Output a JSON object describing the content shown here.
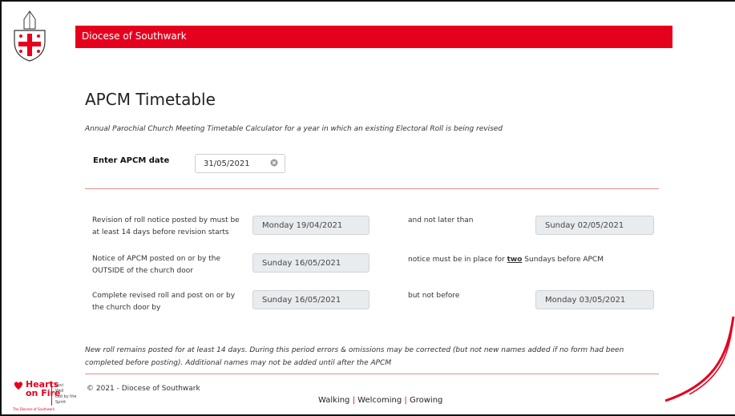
{
  "header": {
    "banner_title": "Diocese of Southwark"
  },
  "page": {
    "title": "APCM Timetable",
    "subtitle": "Annual Parochial Church Meeting Timetable Calculator for a year in which an existing Electoral Roll is being revised"
  },
  "apcm_date": {
    "label": "Enter APCM date",
    "value": "31/05/2021"
  },
  "rows": [
    {
      "left_label_1": "Revision of roll notice posted by must be",
      "left_label_2": "at least 14 days before revision starts",
      "left_value": "Monday 19/04/2021",
      "right_label": "and not later than",
      "right_value": "Sunday 02/05/2021"
    },
    {
      "left_label_1": "Notice of APCM posted on or by the",
      "left_label_2": "OUTSIDE of the church door",
      "left_value": "Sunday 16/05/2021",
      "right_label_pre": "notice must be in place for ",
      "right_label_bold": "two",
      "right_label_post": " Sundays before APCM"
    },
    {
      "left_label_1": "Complete revised roll and post on or by",
      "left_label_2": "the church door by",
      "left_value": "Sunday 16/05/2021",
      "right_label": "but not before",
      "right_value": "Monday 03/05/2021"
    }
  ],
  "note": {
    "line1": "New roll remains posted for at least 14 days. During this period errors & omissions may be corrected (but not new names added if no form had been",
    "line2": "completed before posting). Additional names may not be added until after the APCM"
  },
  "footer": {
    "hof_line1": "Hearts",
    "hof_line2": "on Fire",
    "hof_sub1": "Lovi",
    "hof_sub2": "Well",
    "hof_sub3": "Led by the Spirit",
    "hof_tiny": "The Diocese of Southwark",
    "copyright": "© 2021 - Diocese of Southwark",
    "slogan_1": "Walking",
    "slogan_sep": "|",
    "slogan_2": "Welcoming",
    "slogan_3": "Growing"
  },
  "colors": {
    "brand_red": "#e5001e",
    "divider": "#e88b8b",
    "field_bg": "#e9ecef"
  },
  "icons": {
    "diocese_logo": "diocese-crest-icon",
    "clear": "clear-circle-icon"
  }
}
